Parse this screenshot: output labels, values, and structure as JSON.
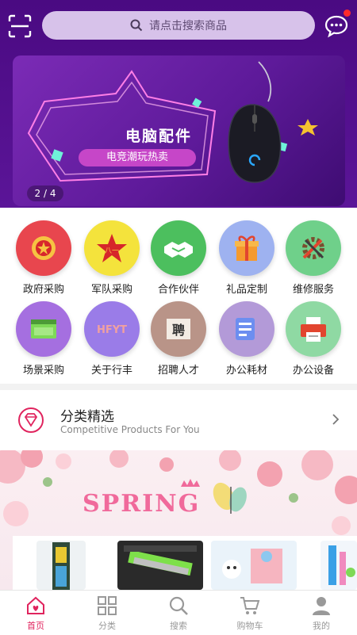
{
  "header": {
    "search_placeholder": "请点击搜索商品"
  },
  "banner": {
    "title": "电脑配件",
    "subtitle": "电竞潮玩热卖",
    "index": "2 / 4"
  },
  "categories": [
    {
      "label": "政府采购",
      "icon": "emblem-icon",
      "color": "#e8464e"
    },
    {
      "label": "军队采购",
      "icon": "army-star-icon",
      "color": "#f4e33c"
    },
    {
      "label": "合作伙伴",
      "icon": "handshake-icon",
      "color": "#4cbf5e"
    },
    {
      "label": "礼品定制",
      "icon": "gift-icon",
      "color": "#9eb2f0"
    },
    {
      "label": "维修服务",
      "icon": "repair-tools-icon",
      "color": "#6fd08a"
    },
    {
      "label": "场景采购",
      "icon": "scene-icon",
      "color": "#a56fe0"
    },
    {
      "label": "关于行丰",
      "icon": "hfyt-logo-icon",
      "color": "#9a7ce8"
    },
    {
      "label": "招聘人才",
      "icon": "recruit-icon",
      "color": "#b99488"
    },
    {
      "label": "办公耗材",
      "icon": "office-supplies-icon",
      "color": "#b39ad8"
    },
    {
      "label": "办公设备",
      "icon": "printer-icon",
      "color": "#8fd9a3"
    }
  ],
  "section": {
    "title": "分类精选",
    "subtitle": "Competitive Products For You"
  },
  "promo": {
    "title": "SPRING"
  },
  "tabs": [
    {
      "label": "首页",
      "icon": "home-icon",
      "active": true
    },
    {
      "label": "分类",
      "icon": "grid-icon",
      "active": false
    },
    {
      "label": "搜索",
      "icon": "search-icon",
      "active": false
    },
    {
      "label": "购物车",
      "icon": "cart-icon",
      "active": false
    },
    {
      "label": "我的",
      "icon": "user-icon",
      "active": false
    }
  ],
  "colors": {
    "header_purple": "#4a0a82",
    "search_bg": "#d7c2ea",
    "accent_pink": "#e0245e"
  }
}
